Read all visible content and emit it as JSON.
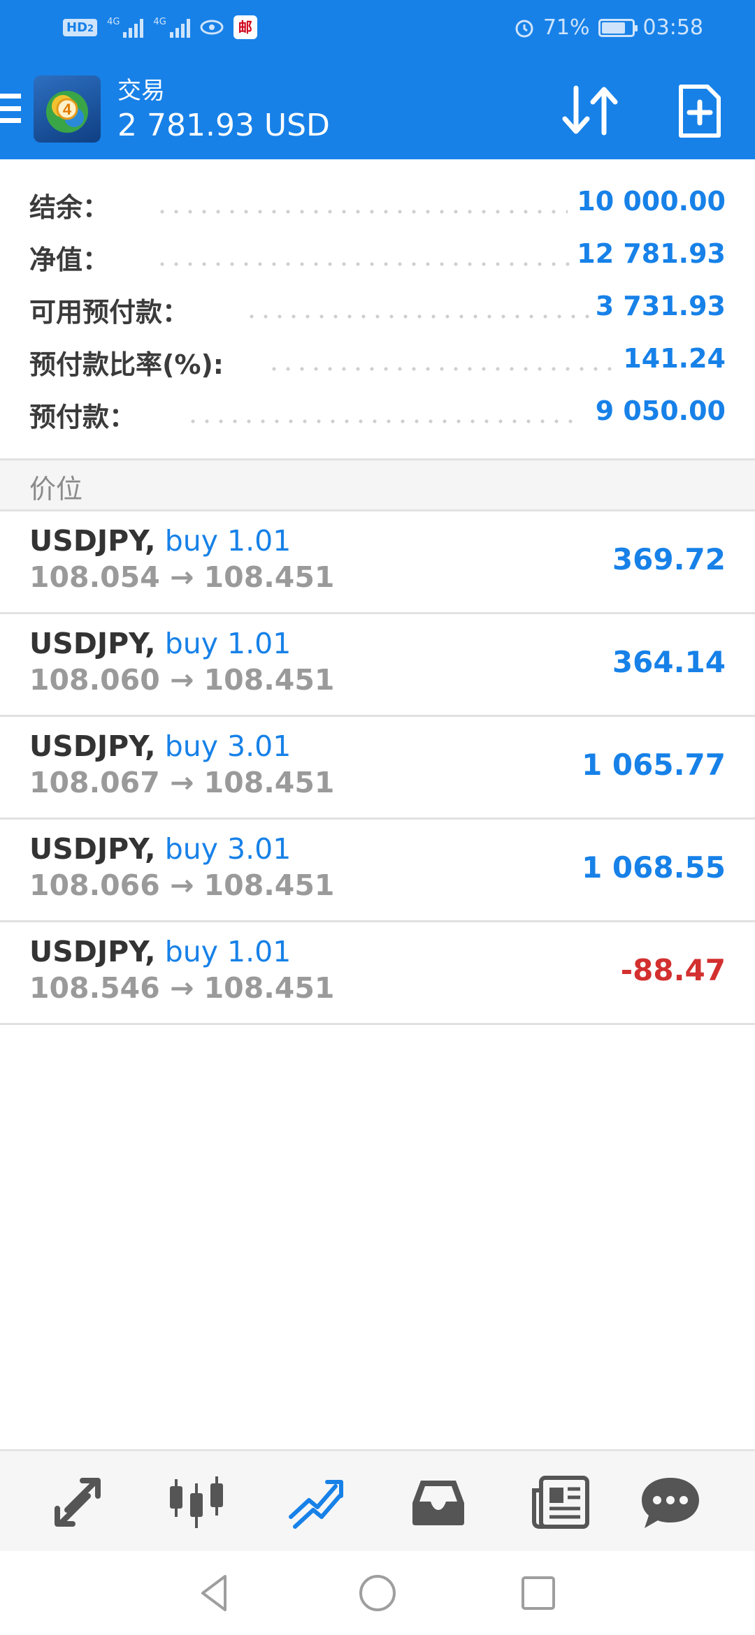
{
  "status_bar": {
    "hd_badge": "HD",
    "hd_index": "2",
    "signal_tag_1": "4G",
    "signal_tag_2": "4G",
    "app_badge": "邮",
    "battery": "71%",
    "battery_level": 0.71,
    "time": "03:58"
  },
  "toolbar": {
    "title": "交易",
    "subtitle": "2 781.93 USD"
  },
  "summary": [
    {
      "label": "结余：",
      "value": "10 000.00"
    },
    {
      "label": "净值：",
      "value": "12 781.93"
    },
    {
      "label": "可用预付款：",
      "value": "3 731.93"
    },
    {
      "label": "预付款比率(%):",
      "value": "141.24"
    },
    {
      "label": "预付款：",
      "value": "9 050.00"
    }
  ],
  "section_title": "价位",
  "positions": [
    {
      "symbol": "USDJPY,",
      "type": "buy 1.01",
      "prices": "108.054 → 108.451",
      "profit": "369.72"
    },
    {
      "symbol": "USDJPY,",
      "type": "buy 1.01",
      "prices": "108.060 → 108.451",
      "profit": "364.14"
    },
    {
      "symbol": "USDJPY,",
      "type": "buy 3.01",
      "prices": "108.067 → 108.451",
      "profit": "1 065.77"
    },
    {
      "symbol": "USDJPY,",
      "type": "buy 3.01",
      "prices": "108.066 → 108.451",
      "profit": "1 068.55"
    },
    {
      "symbol": "USDJPY,",
      "type": "buy 1.01",
      "prices": "108.546 → 108.451",
      "profit": "-88.47"
    }
  ],
  "bottom_nav": [
    {
      "icon": "quotes-arrows-icon",
      "active": false
    },
    {
      "icon": "candlestick-chart-icon",
      "active": false
    },
    {
      "icon": "trade-trend-icon",
      "active": true
    },
    {
      "icon": "inbox-icon",
      "active": false
    },
    {
      "icon": "news-icon",
      "active": false
    },
    {
      "icon": "chat-icon",
      "active": false
    }
  ],
  "colors": {
    "accent": "#1781e8",
    "loss": "#d32f2f",
    "label": "#3b3b3b",
    "muted": "#9a9a9a"
  }
}
